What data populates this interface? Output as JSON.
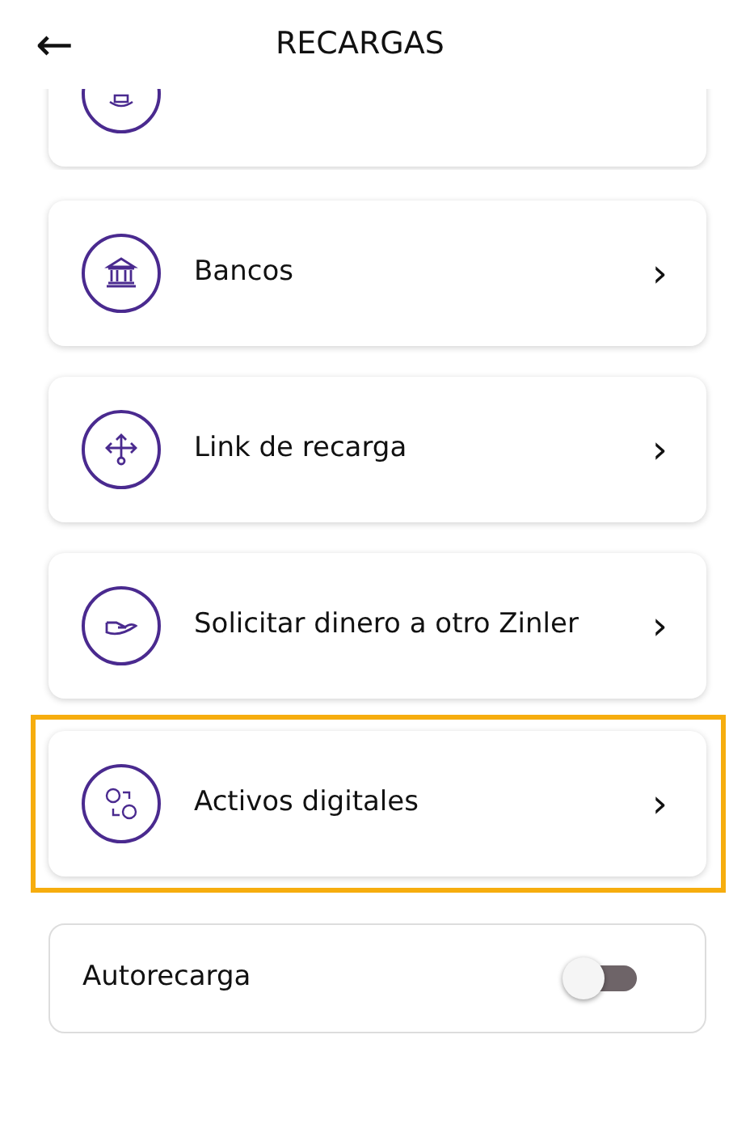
{
  "header": {
    "back": "←",
    "title": "RECARGAS"
  },
  "items": [
    {
      "kind": "option",
      "label": "Bancos",
      "chevron": "›",
      "highlighted": false
    },
    {
      "kind": "option",
      "label": "Link de recarga",
      "chevron": "›",
      "highlighted": false
    },
    {
      "kind": "option",
      "label": "Solicitar dinero a otro Zinler",
      "chevron": "›",
      "highlighted": false
    },
    {
      "kind": "option",
      "label": "Activos digitales",
      "chevron": "›",
      "highlighted": true
    },
    {
      "kind": "toggle",
      "label": "Autorecarga",
      "on": false
    }
  ]
}
